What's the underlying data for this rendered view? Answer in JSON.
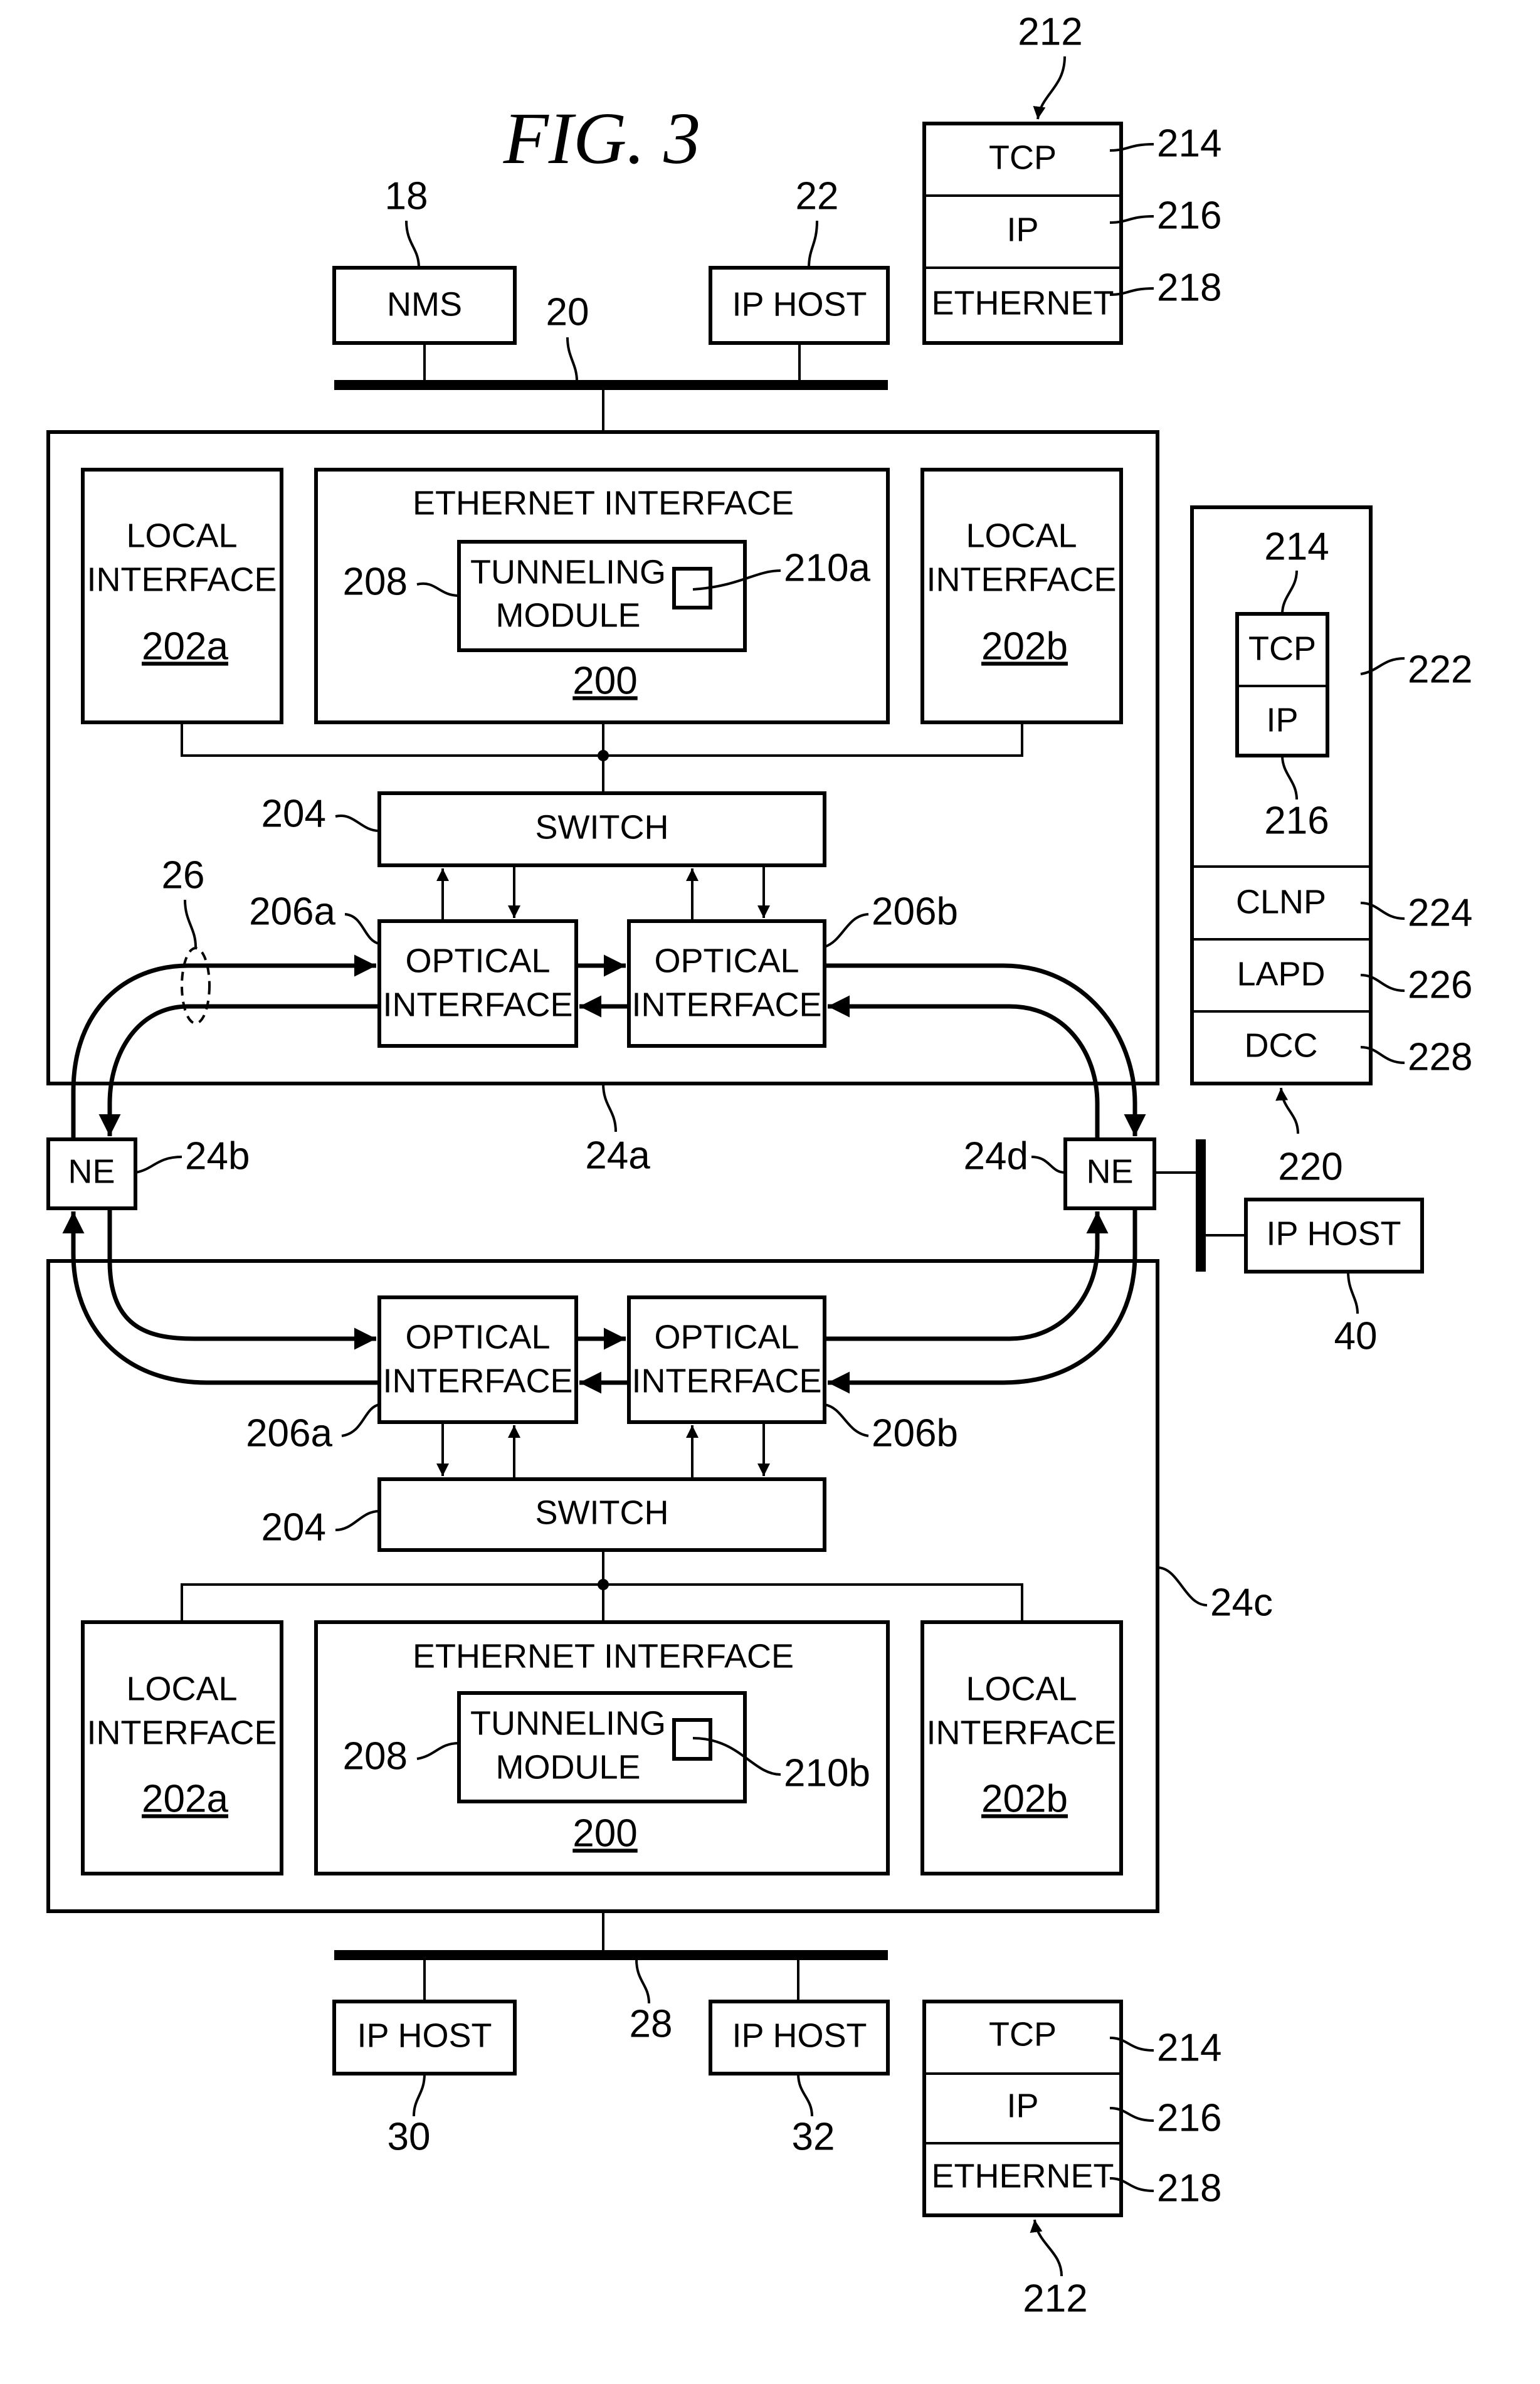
{
  "figure": {
    "title": "FIG. 3"
  },
  "labels": {
    "nms": "NMS",
    "ip_host": "IP HOST",
    "local": "LOCAL",
    "interface": "INTERFACE",
    "ethernet_interface": "ETHERNET INTERFACE",
    "tunneling": "TUNNELING",
    "module": "MODULE",
    "switch": "SWITCH",
    "optical": "OPTICAL",
    "ne": "NE",
    "tcp": "TCP",
    "ip": "IP",
    "ethernet": "ETHERNET",
    "clnp": "CLNP",
    "lapd": "LAPD",
    "dcc": "DCC"
  },
  "refs": {
    "r18": "18",
    "r20": "20",
    "r22": "22",
    "r24a": "24a",
    "r24b": "24b",
    "r24c": "24c",
    "r24d": "24d",
    "r26": "26",
    "r28": "28",
    "r30": "30",
    "r32": "32",
    "r40": "40",
    "r200": "200",
    "r202a": "202a",
    "r202b": "202b",
    "r204": "204",
    "r206a": "206a",
    "r206b": "206b",
    "r208": "208",
    "r210a": "210a",
    "r210b": "210b",
    "r212": "212",
    "r214": "214",
    "r216": "216",
    "r218": "218",
    "r220": "220",
    "r222": "222",
    "r224": "224",
    "r226": "226",
    "r228": "228"
  }
}
